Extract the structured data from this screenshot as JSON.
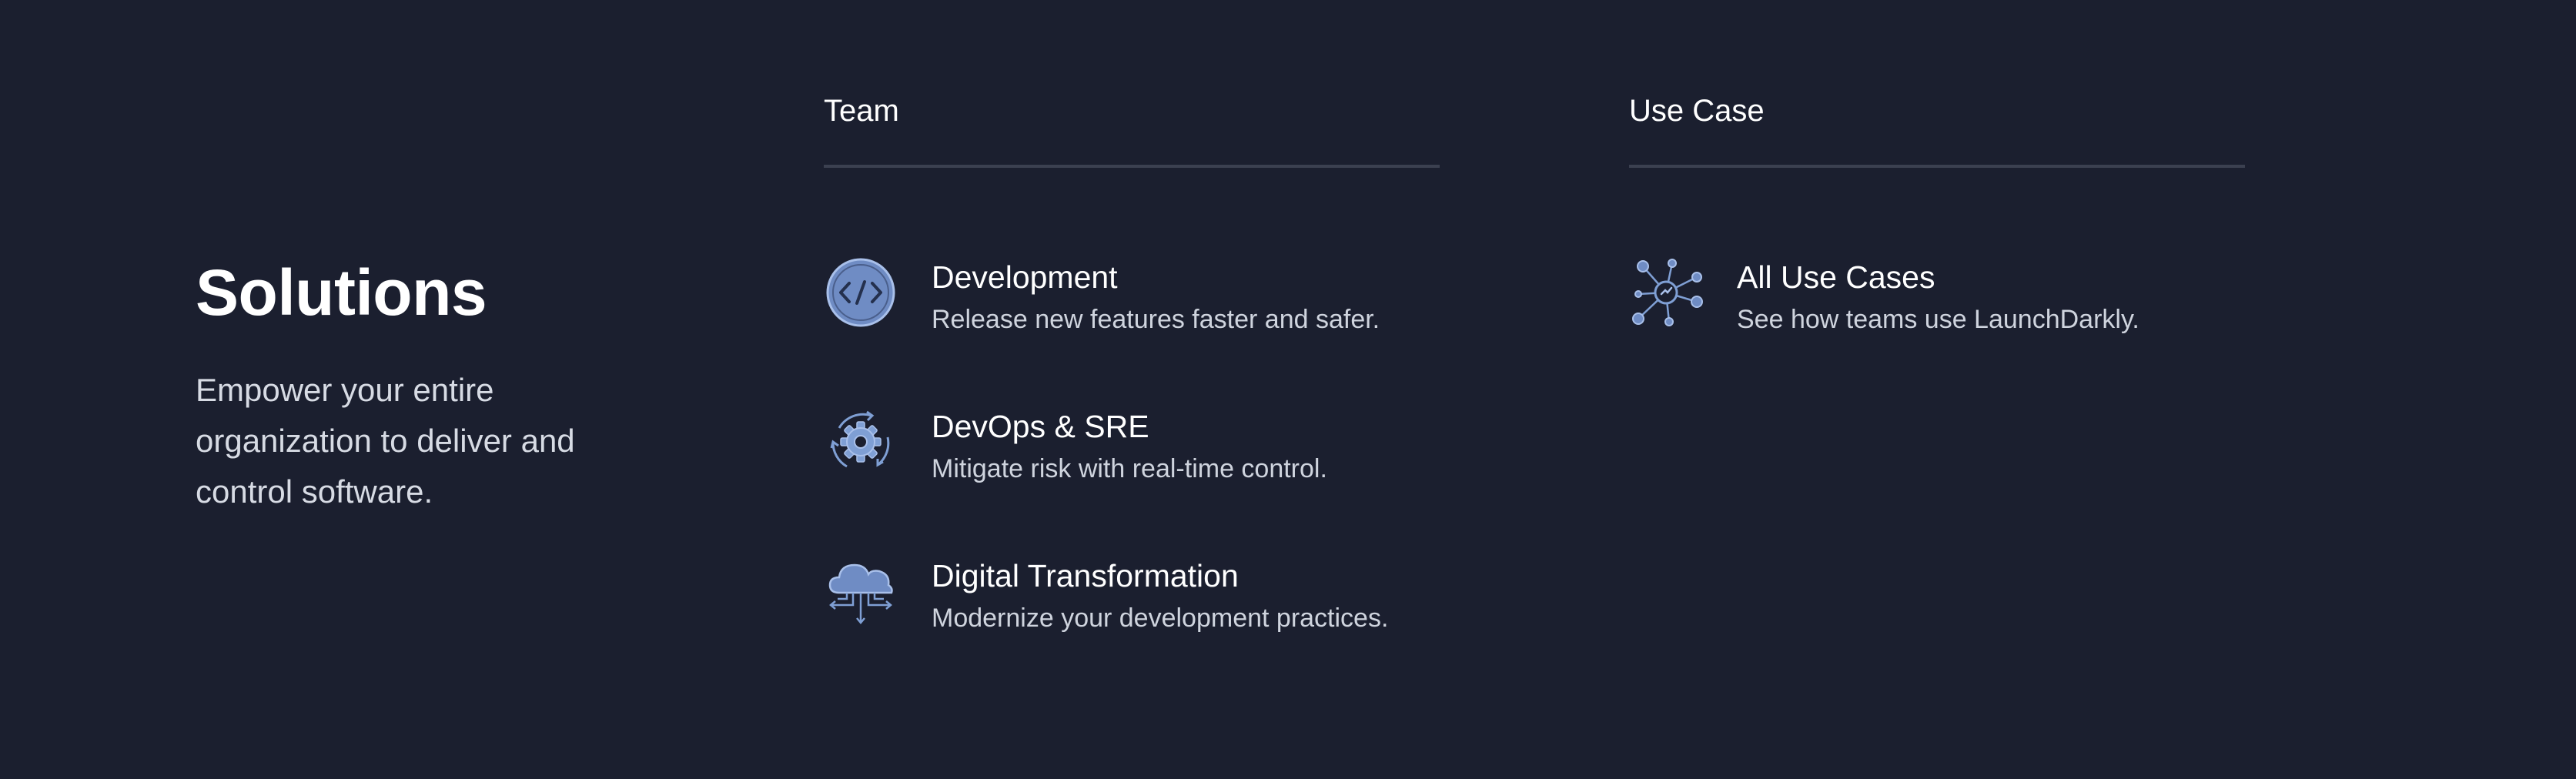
{
  "intro": {
    "title": "Solutions",
    "description": "Empower your entire organization to deliver and control software."
  },
  "team": {
    "header": "Team",
    "items": [
      {
        "title": "Development",
        "description": "Release new features faster and safer.",
        "icon": "code-icon"
      },
      {
        "title": "DevOps & SRE",
        "description": "Mitigate risk with real-time control.",
        "icon": "gear-cycle-icon"
      },
      {
        "title": "Digital Transformation",
        "description": "Modernize your development practices.",
        "icon": "cloud-network-icon"
      }
    ]
  },
  "use_case": {
    "header": "Use Case",
    "items": [
      {
        "title": "All Use Cases",
        "description": "See how teams use LaunchDarkly.",
        "icon": "network-hub-icon"
      }
    ]
  },
  "colors": {
    "background": "#1b1f2f",
    "icon_accent": "#7f9fd4",
    "divider": "#3b4050"
  }
}
